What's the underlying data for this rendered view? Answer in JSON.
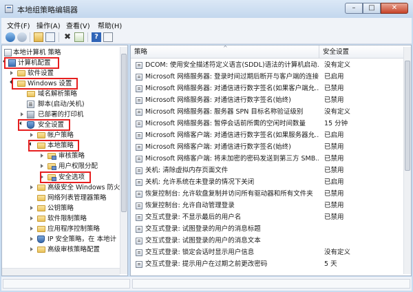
{
  "window": {
    "title": "本地组策略编辑器"
  },
  "menu": [
    {
      "label": "文件(F)"
    },
    {
      "label": "操作(A)"
    },
    {
      "label": "查看(V)"
    },
    {
      "label": "帮助(H)"
    }
  ],
  "toolbar": {
    "buttons": [
      "back-arrow-icon",
      "forward-arrow-icon",
      "folder-up-icon",
      "show-hide-tree-icon",
      "delete-icon",
      "export-icon",
      "help-icon",
      "properties-icon"
    ]
  },
  "tree": {
    "items": [
      {
        "label": "本地计算机 策略",
        "icon": "policy",
        "twisty": "none"
      },
      {
        "label": "计算机配置",
        "icon": "computer",
        "twisty": "open"
      },
      {
        "label": "软件设置",
        "icon": "folder",
        "twisty": "closed"
      },
      {
        "label": "Windows 设置",
        "icon": "folder",
        "twisty": "open"
      },
      {
        "label": "域名解析策略",
        "icon": "folder",
        "twisty": "none"
      },
      {
        "label": "脚本(启动/关机)",
        "icon": "script",
        "twisty": "none"
      },
      {
        "label": "已部署的打印机",
        "icon": "printer",
        "twisty": "closed"
      },
      {
        "label": "安全设置",
        "icon": "shield",
        "twisty": "open"
      },
      {
        "label": "帐户策略",
        "icon": "folder",
        "twisty": "closed"
      },
      {
        "label": "本地策略",
        "icon": "folder",
        "twisty": "open"
      },
      {
        "label": "审核策略",
        "icon": "folder-lock",
        "twisty": "closed"
      },
      {
        "label": "用户权限分配",
        "icon": "folder-lock",
        "twisty": "closed"
      },
      {
        "label": "安全选项",
        "icon": "folder-lock",
        "twisty": "closed"
      },
      {
        "label": "高级安全 Windows 防火",
        "icon": "folder",
        "twisty": "closed"
      },
      {
        "label": "网络列表管理器策略",
        "icon": "folder",
        "twisty": "none"
      },
      {
        "label": "公钥策略",
        "icon": "folder",
        "twisty": "closed"
      },
      {
        "label": "软件限制策略",
        "icon": "folder",
        "twisty": "closed"
      },
      {
        "label": "应用程序控制策略",
        "icon": "folder",
        "twisty": "closed"
      },
      {
        "label": "IP 安全策略，在 本地计",
        "icon": "policy",
        "twisty": "closed"
      },
      {
        "label": "高级审核策略配置",
        "icon": "folder",
        "twisty": "closed"
      }
    ]
  },
  "list": {
    "columns": {
      "policy": "策略",
      "setting": "安全设置"
    },
    "rows": [
      {
        "policy": "DCOM: 使用安全描述符定义语言(SDDL)语法的计算机启动...",
        "setting": "没有定义"
      },
      {
        "policy": "Microsoft 网络服务器: 登录时间过期后断开与客户端的连接",
        "setting": "已启用"
      },
      {
        "policy": "Microsoft 网络服务器: 对通信进行数字签名(如果客户端允...",
        "setting": "已禁用"
      },
      {
        "policy": "Microsoft 网络服务器: 对通信进行数字签名(始终)",
        "setting": "已禁用"
      },
      {
        "policy": "Microsoft 网络服务器: 服务器 SPN 目标名称验证级别",
        "setting": "没有定义"
      },
      {
        "policy": "Microsoft 网络服务器: 暂停会话前所需的空闲时间数量",
        "setting": "15 分钟"
      },
      {
        "policy": "Microsoft 网络客户端: 对通信进行数字签名(如果服务器允...",
        "setting": "已启用"
      },
      {
        "policy": "Microsoft 网络客户端: 对通信进行数字签名(始终)",
        "setting": "已禁用"
      },
      {
        "policy": "Microsoft 网络客户端: 将未加密的密码发送到第三方 SMB...",
        "setting": "已禁用"
      },
      {
        "policy": "关机: 清除虚拟内存页面文件",
        "setting": "已禁用"
      },
      {
        "policy": "关机: 允许系统在未登录的情况下关闭",
        "setting": "已启用"
      },
      {
        "policy": "恢复控制台: 允许软盘复制并访问所有驱动器和所有文件夹",
        "setting": "已禁用"
      },
      {
        "policy": "恢复控制台: 允许自动管理登录",
        "setting": "已禁用"
      },
      {
        "policy": "交互式登录: 不显示最后的用户名",
        "setting": "已禁用"
      },
      {
        "policy": "交互式登录: 试图登录的用户的消息标题",
        "setting": ""
      },
      {
        "policy": "交互式登录: 试图登录的用户的消息文本",
        "setting": ""
      },
      {
        "policy": "交互式登录: 锁定会话时显示用户信息",
        "setting": "没有定义"
      },
      {
        "policy": "交互式登录: 提示用户在过期之前更改密码",
        "setting": "5 天"
      }
    ]
  }
}
